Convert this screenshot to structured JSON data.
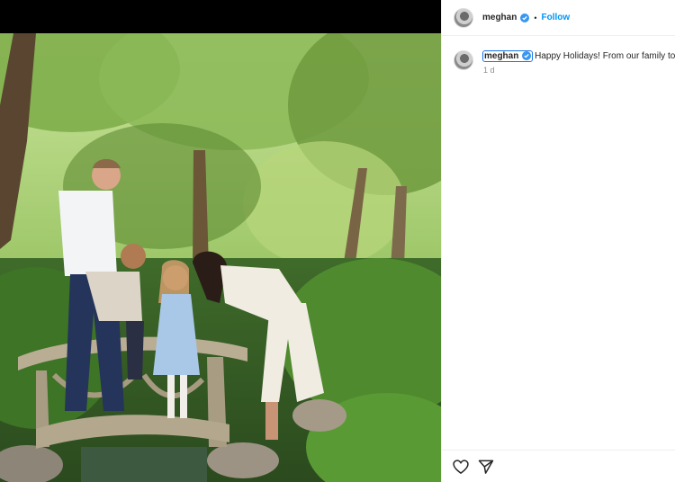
{
  "post": {
    "username": "meghan",
    "separator": "•",
    "follow_label": "Follow",
    "caption_text": "Happy Holidays! From our family to y",
    "timestamp": "1 d"
  },
  "icons": {
    "verified": "verified-badge-icon",
    "like": "heart-icon",
    "share": "paper-plane-icon"
  },
  "colors": {
    "accent": "#0095f6",
    "verified": "#3897f0",
    "text": "#262626",
    "muted": "#8e8e8e"
  }
}
